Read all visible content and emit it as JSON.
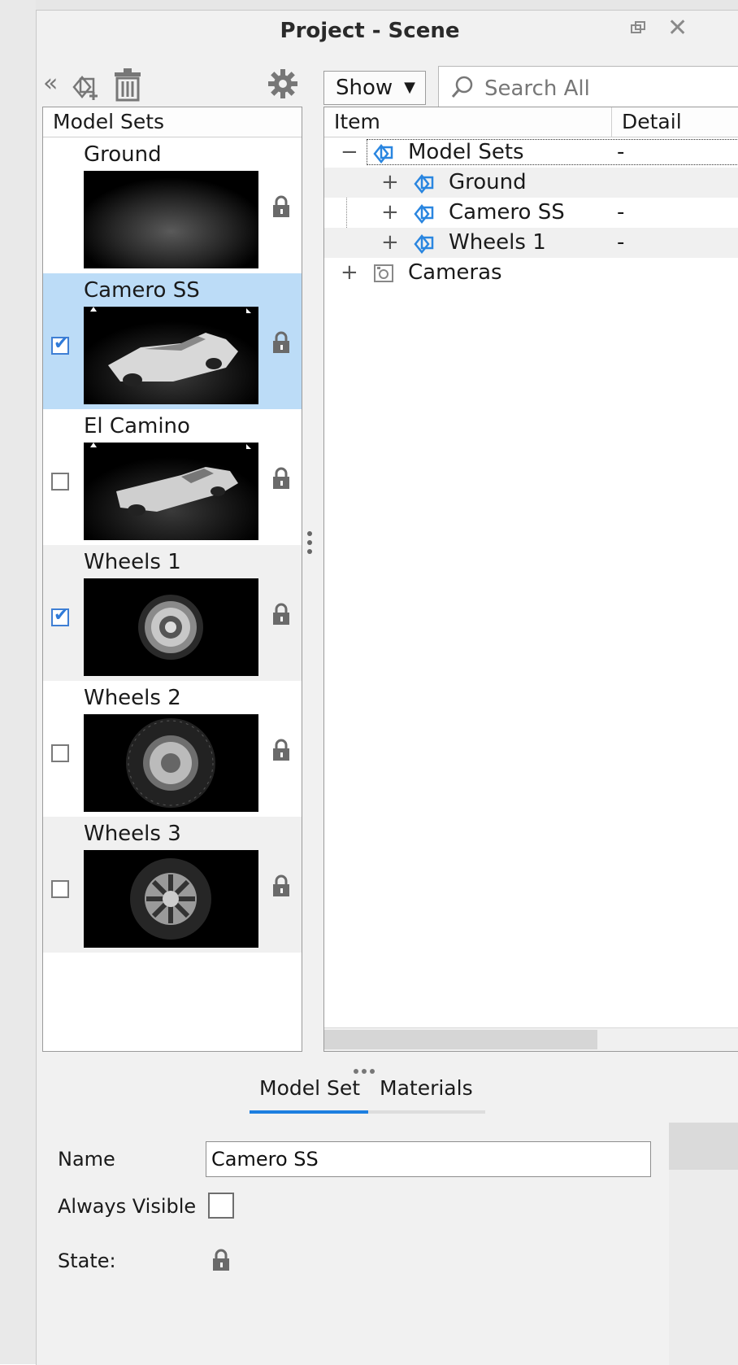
{
  "window": {
    "title": "Project - Scene"
  },
  "toolbar": {
    "collapse_glyph": "«",
    "show_label": "Show",
    "search_placeholder": "Search All"
  },
  "left_panel": {
    "header": "Model Sets",
    "items": [
      {
        "name": "Ground",
        "checkbox": "none",
        "selected": false,
        "alt": false,
        "thumb": "ground"
      },
      {
        "name": "Camero SS",
        "checkbox": "checked",
        "selected": true,
        "alt": false,
        "thumb": "car"
      },
      {
        "name": "El Camino",
        "checkbox": "unchecked",
        "selected": false,
        "alt": false,
        "thumb": "car"
      },
      {
        "name": "Wheels 1",
        "checkbox": "checked",
        "selected": false,
        "alt": true,
        "thumb": "wheel"
      },
      {
        "name": "Wheels 2",
        "checkbox": "unchecked",
        "selected": false,
        "alt": false,
        "thumb": "tire"
      },
      {
        "name": "Wheels 3",
        "checkbox": "unchecked",
        "selected": false,
        "alt": true,
        "thumb": "rim"
      }
    ]
  },
  "tree": {
    "columns": {
      "item": "Item",
      "detail": "Detail"
    },
    "rows": [
      {
        "expander": "−",
        "icon": "model-set-icon",
        "label": "Model Sets",
        "detail": "-",
        "level": 0
      },
      {
        "expander": "+",
        "icon": "model-set-icon",
        "label": "Ground",
        "detail": "",
        "level": 1
      },
      {
        "expander": "+",
        "icon": "model-set-icon",
        "label": "Camero SS",
        "detail": "-",
        "level": 1
      },
      {
        "expander": "+",
        "icon": "model-set-icon",
        "label": "Wheels 1",
        "detail": "-",
        "level": 1
      },
      {
        "expander": "+",
        "icon": "camera-icon",
        "label": "Cameras",
        "detail": "",
        "level": 0
      }
    ]
  },
  "tabs": [
    {
      "label": "Model Set",
      "active": true
    },
    {
      "label": "Materials",
      "active": false
    }
  ],
  "properties": {
    "name_label": "Name",
    "name_value": "Camero SS",
    "always_visible_label": "Always Visible",
    "always_visible": false,
    "state_label": "State:"
  },
  "colors": {
    "selection": "#bcdcf7",
    "accent": "#1d7fe0",
    "tree_icon": "#2a86e0"
  }
}
